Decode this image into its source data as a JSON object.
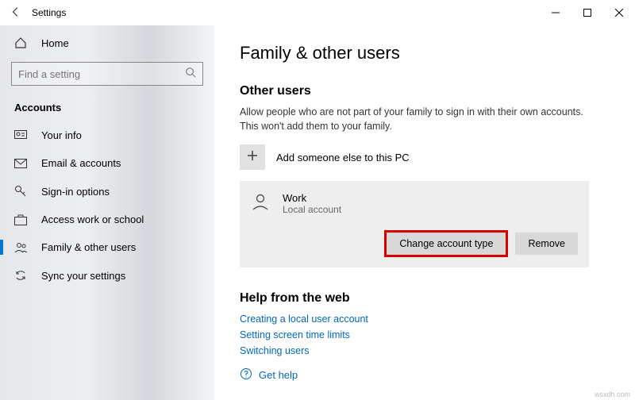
{
  "titlebar": {
    "title": "Settings"
  },
  "sidebar": {
    "home": "Home",
    "search_placeholder": "Find a setting",
    "section": "Accounts",
    "items": [
      {
        "label": "Your info"
      },
      {
        "label": "Email & accounts"
      },
      {
        "label": "Sign-in options"
      },
      {
        "label": "Access work or school"
      },
      {
        "label": "Family & other users"
      },
      {
        "label": "Sync your settings"
      }
    ]
  },
  "main": {
    "title": "Family & other users",
    "other_users_head": "Other users",
    "other_users_desc": "Allow people who are not part of your family to sign in with their own accounts. This won't add them to your family.",
    "add_label": "Add someone else to this PC",
    "user": {
      "name": "Work",
      "sub": "Local account"
    },
    "btn_change": "Change account type",
    "btn_remove": "Remove",
    "help_head": "Help from the web",
    "help_links": [
      "Creating a local user account",
      "Setting screen time limits",
      "Switching users"
    ],
    "get_help": "Get help"
  },
  "watermark": "wsxdh.com"
}
